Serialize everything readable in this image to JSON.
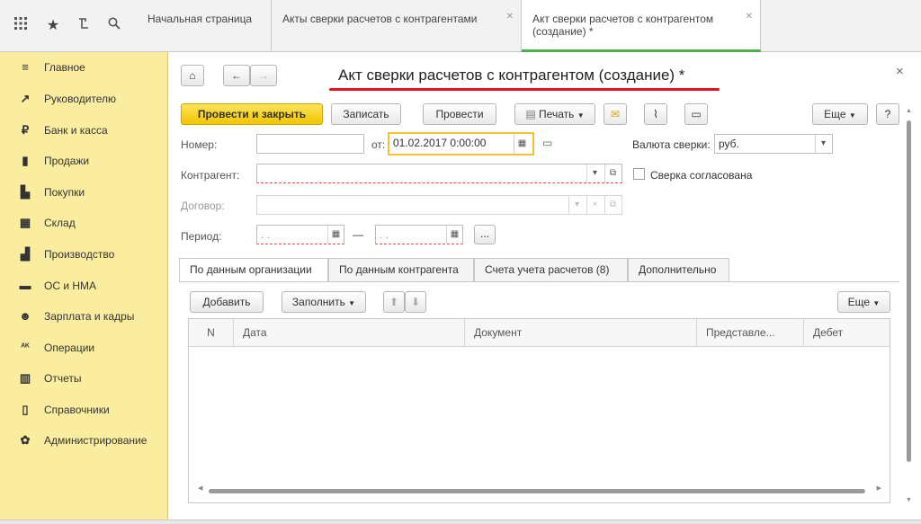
{
  "tabs": [
    {
      "label": "Начальная страница"
    },
    {
      "label": "Акты сверки расчетов с контрагентами"
    },
    {
      "label": "Акт сверки расчетов с контрагентом (создание) *"
    }
  ],
  "sidebar": {
    "items": [
      {
        "label": "Главное",
        "icon": "≡"
      },
      {
        "label": "Руководителю",
        "icon": "↗"
      },
      {
        "label": "Банк и касса",
        "icon": "₽"
      },
      {
        "label": "Продажи",
        "icon": "▮"
      },
      {
        "label": "Покупки",
        "icon": "▙"
      },
      {
        "label": "Склад",
        "icon": "▦"
      },
      {
        "label": "Производство",
        "icon": "▟"
      },
      {
        "label": "ОС и НМА",
        "icon": "▬"
      },
      {
        "label": "Зарплата и кадры",
        "icon": "☻"
      },
      {
        "label": "Операции",
        "icon": "ᴬᴷ"
      },
      {
        "label": "Отчеты",
        "icon": "▥"
      },
      {
        "label": "Справочники",
        "icon": "▯"
      },
      {
        "label": "Администрирование",
        "icon": "✿"
      }
    ]
  },
  "form": {
    "title": "Акт сверки расчетов с контрагентом (создание) *",
    "close": "×",
    "toolbar": {
      "post_close": "Провести и закрыть",
      "save": "Записать",
      "post": "Провести",
      "print": "Печать",
      "more": "Еще",
      "help": "?"
    },
    "number_label": "Номер:",
    "number_value": "",
    "date_label": "от:",
    "date_value": "01.02.2017  0:00:00",
    "currency_label": "Валюта сверки:",
    "currency_value": "руб.",
    "counterparty_label": "Контрагент:",
    "agreed_label": "Сверка согласована",
    "contract_label": "Договор:",
    "period_label": "Период:",
    "period_start": " .  .    ",
    "period_end": " .  .    ",
    "period_dash": "—",
    "ellipsis": "...",
    "inner_tabs": [
      {
        "label": "По данным организации"
      },
      {
        "label": "По данным контрагента"
      },
      {
        "label": "Счета учета расчетов (8)"
      },
      {
        "label": "Дополнительно"
      }
    ],
    "table_toolbar": {
      "add": "Добавить",
      "fill": "Заполнить",
      "more": "Еще"
    },
    "columns": [
      "N",
      "Дата",
      "Документ",
      "Представле...",
      "Дебет"
    ]
  },
  "colors": {
    "sidebar_bg": "#fbeda0",
    "accent_yellow": "#f2c400",
    "tab_active_underline": "#4cae4c",
    "title_underline": "#e0141e"
  }
}
